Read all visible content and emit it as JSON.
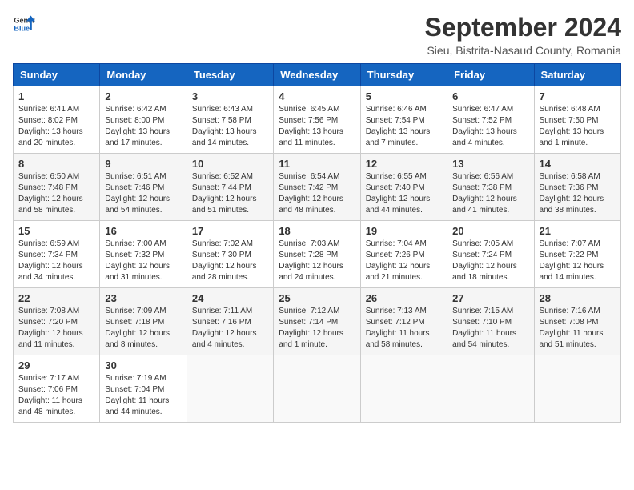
{
  "header": {
    "logo_general": "General",
    "logo_blue": "Blue",
    "title": "September 2024",
    "subtitle": "Sieu, Bistrita-Nasaud County, Romania"
  },
  "weekdays": [
    "Sunday",
    "Monday",
    "Tuesday",
    "Wednesday",
    "Thursday",
    "Friday",
    "Saturday"
  ],
  "weeks": [
    [
      {
        "day": "1",
        "sunrise": "6:41 AM",
        "sunset": "8:02 PM",
        "daylight": "13 hours and 20 minutes."
      },
      {
        "day": "2",
        "sunrise": "6:42 AM",
        "sunset": "8:00 PM",
        "daylight": "13 hours and 17 minutes."
      },
      {
        "day": "3",
        "sunrise": "6:43 AM",
        "sunset": "7:58 PM",
        "daylight": "13 hours and 14 minutes."
      },
      {
        "day": "4",
        "sunrise": "6:45 AM",
        "sunset": "7:56 PM",
        "daylight": "13 hours and 11 minutes."
      },
      {
        "day": "5",
        "sunrise": "6:46 AM",
        "sunset": "7:54 PM",
        "daylight": "13 hours and 7 minutes."
      },
      {
        "day": "6",
        "sunrise": "6:47 AM",
        "sunset": "7:52 PM",
        "daylight": "13 hours and 4 minutes."
      },
      {
        "day": "7",
        "sunrise": "6:48 AM",
        "sunset": "7:50 PM",
        "daylight": "13 hours and 1 minute."
      }
    ],
    [
      {
        "day": "8",
        "sunrise": "6:50 AM",
        "sunset": "7:48 PM",
        "daylight": "12 hours and 58 minutes."
      },
      {
        "day": "9",
        "sunrise": "6:51 AM",
        "sunset": "7:46 PM",
        "daylight": "12 hours and 54 minutes."
      },
      {
        "day": "10",
        "sunrise": "6:52 AM",
        "sunset": "7:44 PM",
        "daylight": "12 hours and 51 minutes."
      },
      {
        "day": "11",
        "sunrise": "6:54 AM",
        "sunset": "7:42 PM",
        "daylight": "12 hours and 48 minutes."
      },
      {
        "day": "12",
        "sunrise": "6:55 AM",
        "sunset": "7:40 PM",
        "daylight": "12 hours and 44 minutes."
      },
      {
        "day": "13",
        "sunrise": "6:56 AM",
        "sunset": "7:38 PM",
        "daylight": "12 hours and 41 minutes."
      },
      {
        "day": "14",
        "sunrise": "6:58 AM",
        "sunset": "7:36 PM",
        "daylight": "12 hours and 38 minutes."
      }
    ],
    [
      {
        "day": "15",
        "sunrise": "6:59 AM",
        "sunset": "7:34 PM",
        "daylight": "12 hours and 34 minutes."
      },
      {
        "day": "16",
        "sunrise": "7:00 AM",
        "sunset": "7:32 PM",
        "daylight": "12 hours and 31 minutes."
      },
      {
        "day": "17",
        "sunrise": "7:02 AM",
        "sunset": "7:30 PM",
        "daylight": "12 hours and 28 minutes."
      },
      {
        "day": "18",
        "sunrise": "7:03 AM",
        "sunset": "7:28 PM",
        "daylight": "12 hours and 24 minutes."
      },
      {
        "day": "19",
        "sunrise": "7:04 AM",
        "sunset": "7:26 PM",
        "daylight": "12 hours and 21 minutes."
      },
      {
        "day": "20",
        "sunrise": "7:05 AM",
        "sunset": "7:24 PM",
        "daylight": "12 hours and 18 minutes."
      },
      {
        "day": "21",
        "sunrise": "7:07 AM",
        "sunset": "7:22 PM",
        "daylight": "12 hours and 14 minutes."
      }
    ],
    [
      {
        "day": "22",
        "sunrise": "7:08 AM",
        "sunset": "7:20 PM",
        "daylight": "12 hours and 11 minutes."
      },
      {
        "day": "23",
        "sunrise": "7:09 AM",
        "sunset": "7:18 PM",
        "daylight": "12 hours and 8 minutes."
      },
      {
        "day": "24",
        "sunrise": "7:11 AM",
        "sunset": "7:16 PM",
        "daylight": "12 hours and 4 minutes."
      },
      {
        "day": "25",
        "sunrise": "7:12 AM",
        "sunset": "7:14 PM",
        "daylight": "12 hours and 1 minute."
      },
      {
        "day": "26",
        "sunrise": "7:13 AM",
        "sunset": "7:12 PM",
        "daylight": "11 hours and 58 minutes."
      },
      {
        "day": "27",
        "sunrise": "7:15 AM",
        "sunset": "7:10 PM",
        "daylight": "11 hours and 54 minutes."
      },
      {
        "day": "28",
        "sunrise": "7:16 AM",
        "sunset": "7:08 PM",
        "daylight": "11 hours and 51 minutes."
      }
    ],
    [
      {
        "day": "29",
        "sunrise": "7:17 AM",
        "sunset": "7:06 PM",
        "daylight": "11 hours and 48 minutes."
      },
      {
        "day": "30",
        "sunrise": "7:19 AM",
        "sunset": "7:04 PM",
        "daylight": "11 hours and 44 minutes."
      },
      null,
      null,
      null,
      null,
      null
    ]
  ]
}
